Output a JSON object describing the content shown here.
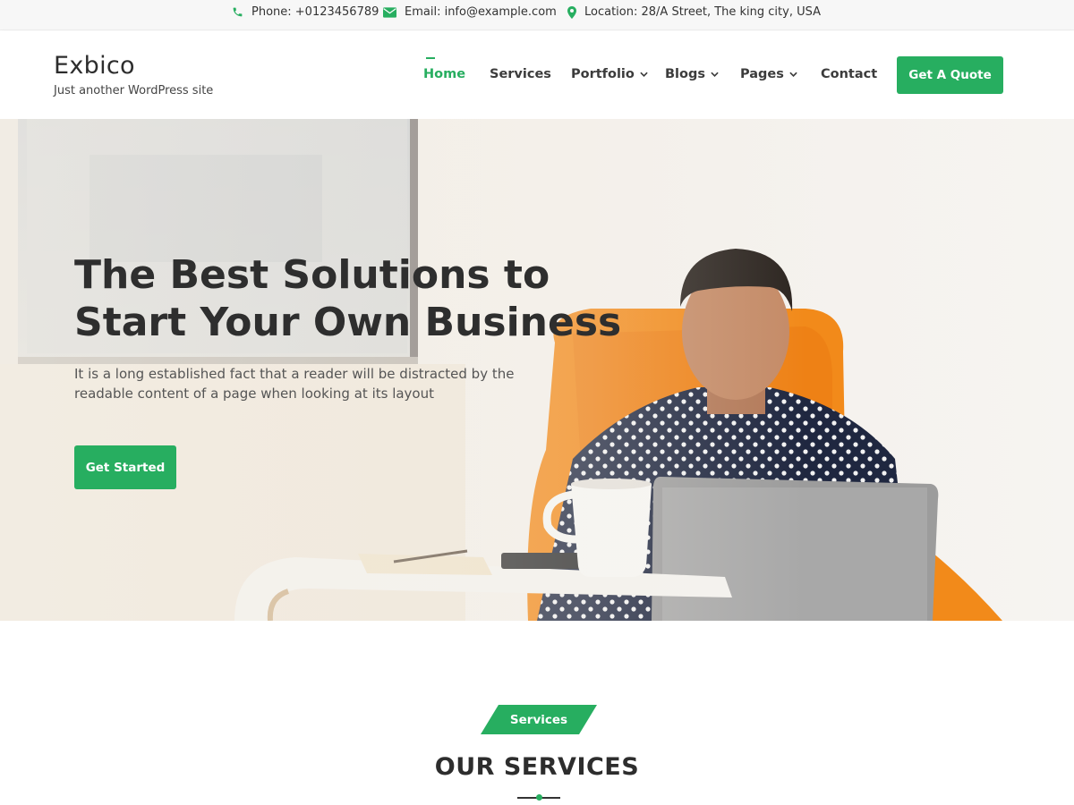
{
  "topbar": {
    "phone": "Phone: +0123456789",
    "email": "Email: info@example.com",
    "location": "Location: 28/A Street, The king city, USA",
    "icons": [
      "phone-icon",
      "envelope-icon",
      "map-pin-icon"
    ]
  },
  "header": {
    "site_title": "Exbico",
    "tagline": "Just another WordPress site",
    "nav": {
      "home": "Home",
      "services": "Services",
      "portfolio": "Portfolio",
      "blogs": "Blogs",
      "pages": "Pages",
      "contact": "Contact"
    },
    "active_item": "Home",
    "quote_button": "Get A Quote"
  },
  "hero": {
    "title_line1": "The Best Solutions to",
    "title_line2": "Start Your Own Business",
    "subtitle": "It is a long established fact that a reader will be distracted by the readable content of a page when looking at its layout",
    "cta": "Get Started"
  },
  "services_section": {
    "tag": "Services",
    "heading": "OUR SERVICES"
  },
  "colors": {
    "accent": "#27ae60",
    "text_dark": "#2d2d2d",
    "chair_orange": "#f28a1a"
  }
}
